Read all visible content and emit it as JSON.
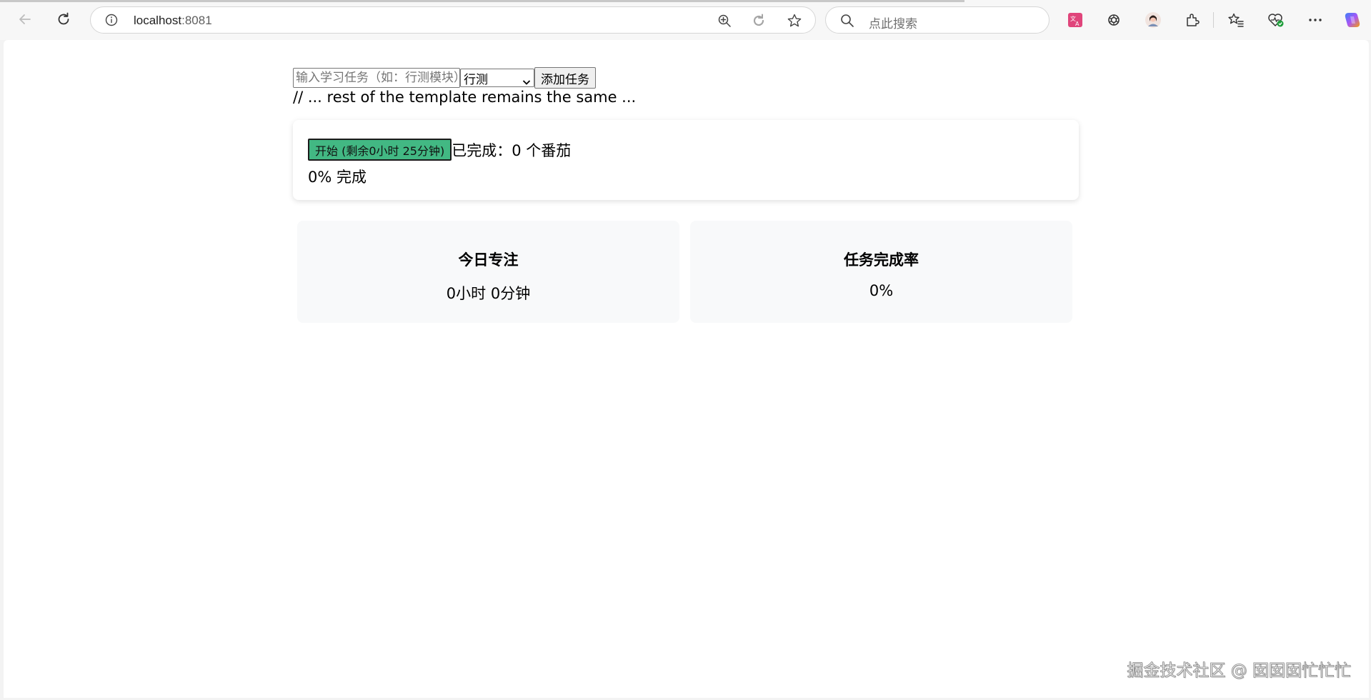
{
  "browser": {
    "address_host": "localhost",
    "address_port": ":8081",
    "search_placeholder": "点此搜索",
    "icons": [
      "back-arrow-icon",
      "refresh-icon",
      "info-icon",
      "zoom-icon",
      "reader-icon",
      "favorite-star-icon",
      "search-icon",
      "translate-icon",
      "chatgpt-icon",
      "profile-avatar-icon",
      "extensions-icon",
      "favorites-icon",
      "browser-essentials-icon",
      "more-icon",
      "copilot-icon"
    ]
  },
  "form": {
    "task_placeholder": "输入学习任务（如：行测模块）",
    "category_value": "行测",
    "add_button": "添加任务"
  },
  "note": "// ... rest of the template remains the same ...",
  "timer": {
    "start_button": "开始 (剩余0小时 25分钟)",
    "completed_text": "已完成：0 个番茄",
    "progress_text": "0% 完成",
    "start_button_color": "#42b883"
  },
  "stats": {
    "focus_title": "今日专注",
    "focus_value": "0小时 0分钟",
    "rate_title": "任务完成率",
    "rate_value": "0%"
  },
  "watermark": "掘金技术社区 @ 囡囡囡忙忙忙"
}
